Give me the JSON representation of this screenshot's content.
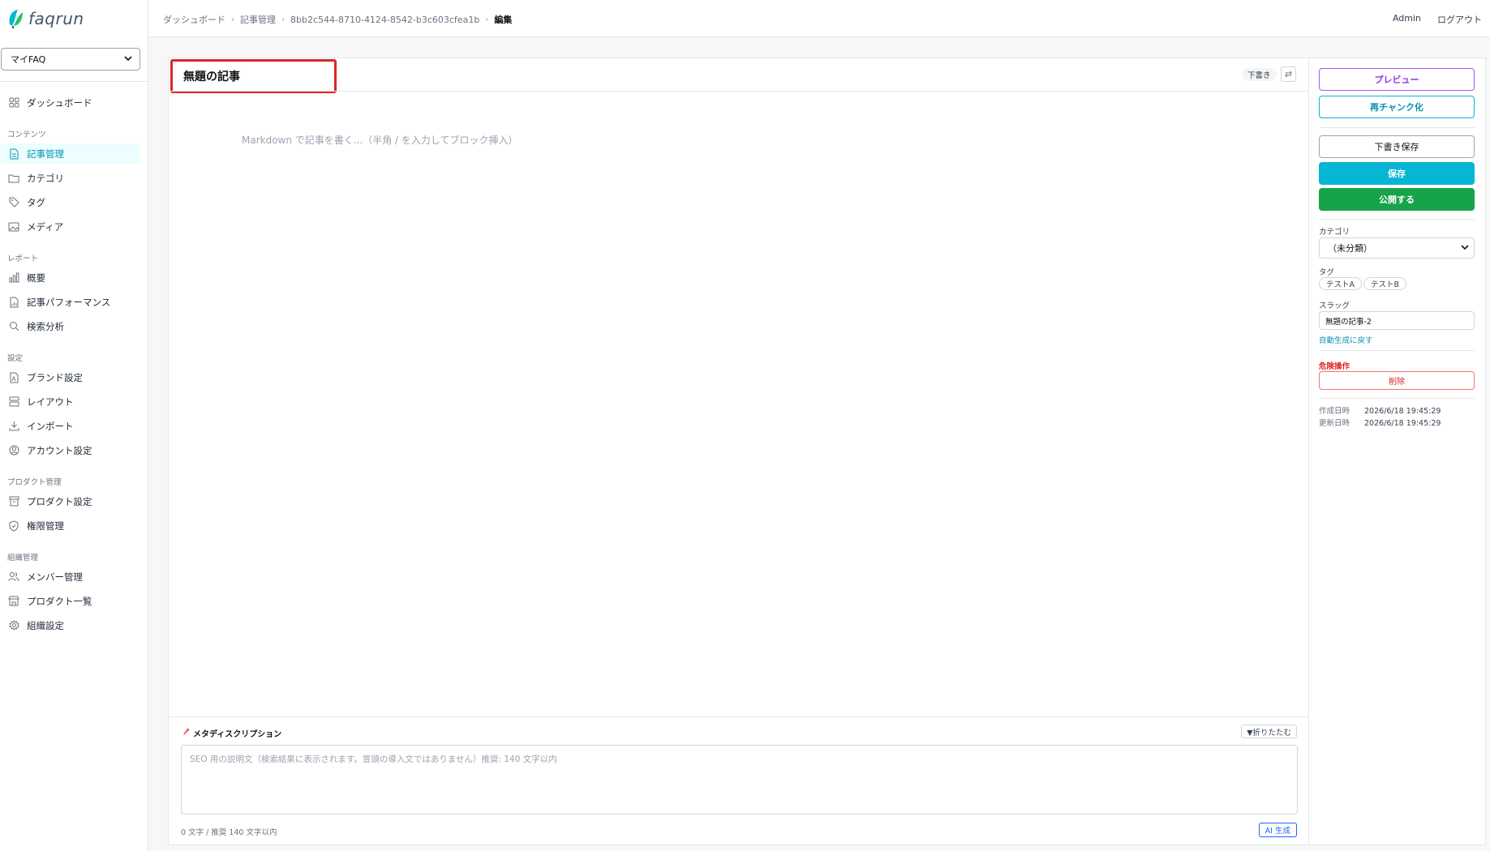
{
  "app": {
    "logo_text": "faqrun"
  },
  "sidebar": {
    "workspace_select": "マイFAQ",
    "top_items": [
      {
        "label": "ダッシュボード",
        "icon": "grid-icon"
      }
    ],
    "sections": [
      {
        "title": "コンテンツ",
        "items": [
          {
            "label": "記事管理",
            "icon": "document-icon",
            "active": true
          },
          {
            "label": "カテゴリ",
            "icon": "folder-icon"
          },
          {
            "label": "タグ",
            "icon": "tag-icon"
          },
          {
            "label": "メディア",
            "icon": "image-icon"
          }
        ]
      },
      {
        "title": "レポート",
        "items": [
          {
            "label": "概要",
            "icon": "bar-chart-icon"
          },
          {
            "label": "記事パフォーマンス",
            "icon": "document-chart-icon"
          },
          {
            "label": "検索分析",
            "icon": "search-icon"
          }
        ]
      },
      {
        "title": "設定",
        "items": [
          {
            "label": "ブランド設定",
            "icon": "brand-icon"
          },
          {
            "label": "レイアウト",
            "icon": "layout-icon"
          },
          {
            "label": "インポート",
            "icon": "download-icon"
          },
          {
            "label": "アカウント設定",
            "icon": "user-circle-icon"
          }
        ]
      },
      {
        "title": "プロダクト管理",
        "items": [
          {
            "label": "プロダクト設定",
            "icon": "archive-icon"
          },
          {
            "label": "権限管理",
            "icon": "shield-icon"
          }
        ]
      },
      {
        "title": "組織管理",
        "items": [
          {
            "label": "メンバー管理",
            "icon": "users-icon"
          },
          {
            "label": "プロダクト一覧",
            "icon": "store-icon"
          },
          {
            "label": "組織設定",
            "icon": "gear-icon"
          }
        ]
      }
    ]
  },
  "topbar": {
    "breadcrumb": [
      "ダッシュボード",
      "記事管理",
      "8bb2c544-8710-4124-8542-b3c603cfea1b",
      "編集"
    ],
    "user": "Admin",
    "logout": "ログアウト"
  },
  "editor": {
    "title": "無題の記事",
    "status_badge": "下書き",
    "swap_icon": "⇄",
    "body_placeholder": "Markdown で記事を書く...（半角 / を入力してブロック挿入）",
    "meta": {
      "title": "メタディスクリプション",
      "collapse_label": "▼折りたたむ",
      "placeholder": "SEO 用の説明文（検索結果に表示されます。冒頭の導入文ではありません）推奨: 140 文字以内",
      "char_count": "0 文字 / 推奨 140 文字以内",
      "ai_button": "AI 生成"
    }
  },
  "panel": {
    "preview": "プレビュー",
    "rechunk": "再チャンク化",
    "save_draft": "下書き保存",
    "save": "保存",
    "publish": "公開する",
    "category_label": "カテゴリ",
    "category_value": "（未分類）",
    "tag_label": "タグ",
    "tags": [
      "テストA",
      "テストB"
    ],
    "slug_label": "スラッグ",
    "slug_value": "無題の記事-2",
    "slug_reset": "自動生成に戻す",
    "danger_label": "危険操作",
    "delete": "削除",
    "created_label": "作成日時",
    "created_value": "2026/6/18 19:45:29",
    "updated_label": "更新日時",
    "updated_value": "2026/6/18 19:45:29"
  },
  "colors": {
    "accent": "#06b6d4",
    "publish": "#16a34a",
    "danger": "#dc2626",
    "preview": "#9333ea"
  }
}
